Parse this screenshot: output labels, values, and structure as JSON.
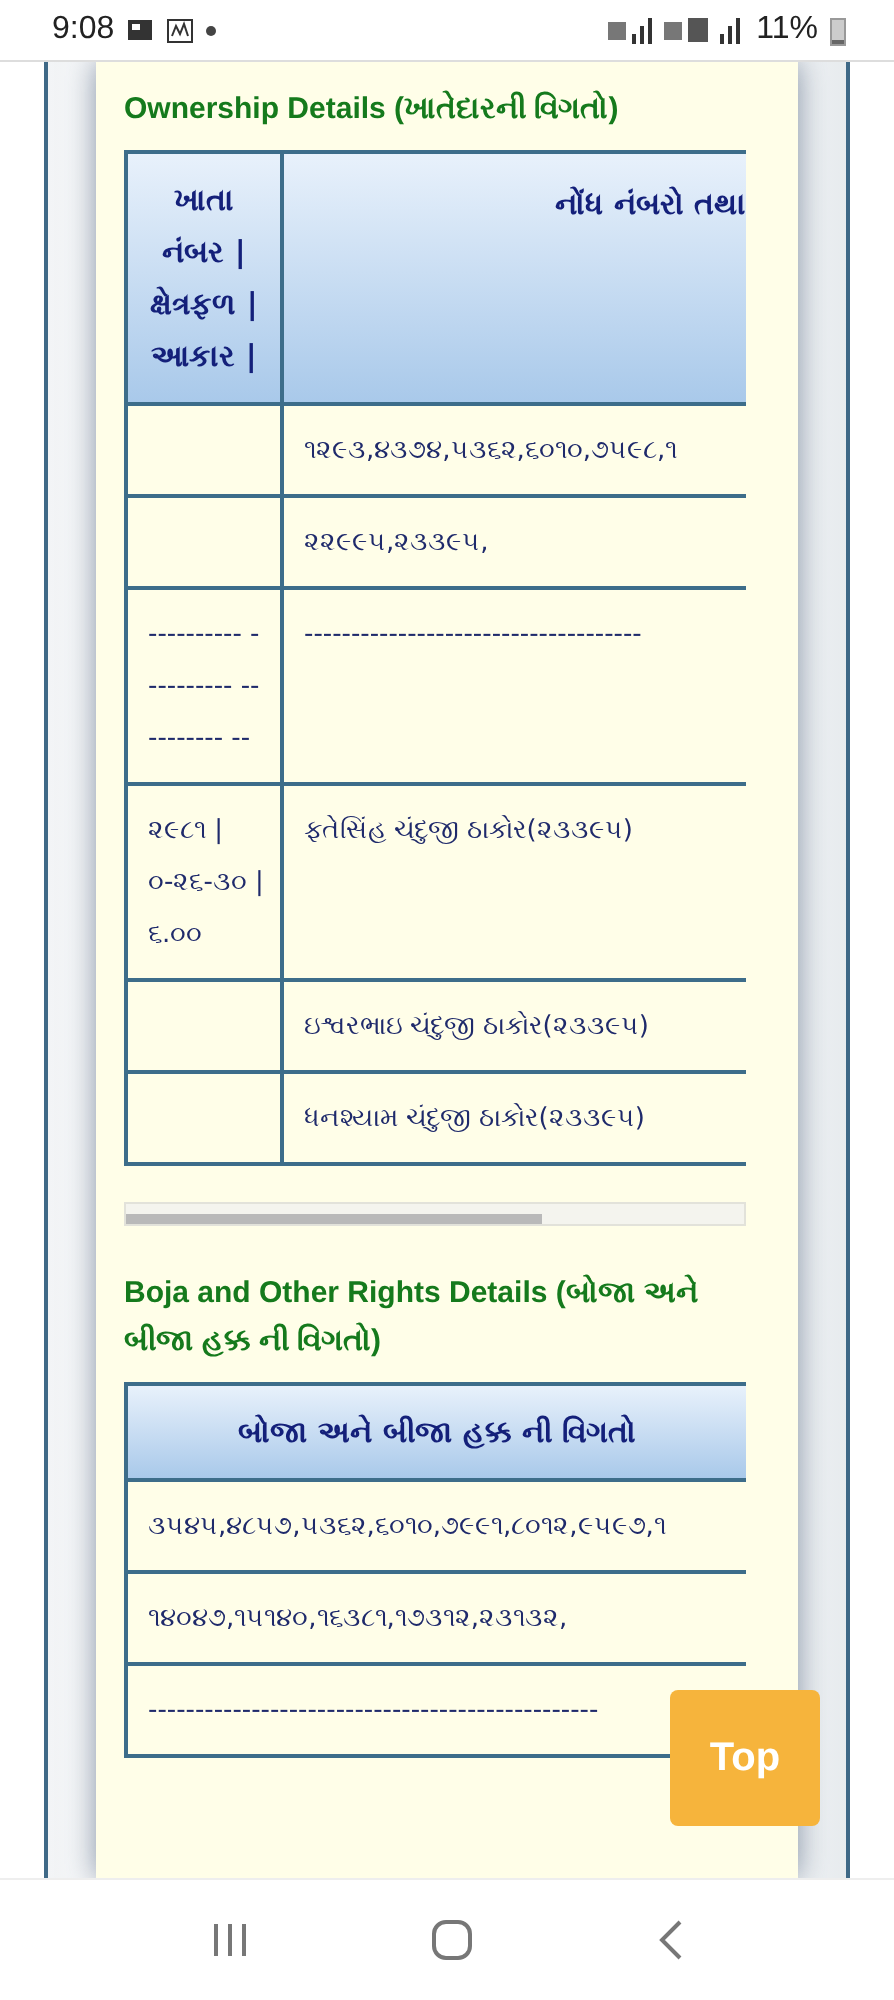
{
  "status_bar": {
    "time": "9:08",
    "battery": "11%"
  },
  "sections": [
    {
      "title": "Ownership Details (ખાતેદારની વિગતો)",
      "columns": [
        "ખાતા નંબર | ક્ષેત્રફળ | આકાર |",
        "નોંધ નંબરો તથા"
      ],
      "rows": [
        [
          "",
          "૧૨૯૩,૪૩૭૪,૫૩૬૨,૬૦૧૦,૭૫૯૮,૧"
        ],
        [
          "",
          "૨૨૯૯૫,૨૩૩૯૫,"
        ],
        [
          "---------- ---------- ---------- --",
          "------------------------------------"
        ],
        [
          "૨૯૮૧ | ૦-૨૬-૩૦ | ૬.૦૦",
          "ફતેસિંહ ચંદુજી ઠાકોર(૨૩૩૯૫)"
        ],
        [
          "",
          "ઇશ્વરભાઇ ચંદુજી ઠાકોર(૨૩૩૯૫)"
        ],
        [
          "",
          "ધનશ્યામ ચંદુજી ઠાકોર(૨૩૩૯૫)"
        ]
      ]
    },
    {
      "title": "Boja and Other Rights Details (બોજા અને બીજા હક્ક ની વિગતો)",
      "columns": [
        "બોજા અને બીજા હક્ક ની વિગતો"
      ],
      "rows": [
        [
          "૩૫૪૫,૪૮૫૭,૫૩૬૨,૬૦૧૦,૭૯૯૧,૮૦૧૨,૯૫૯૭,૧"
        ],
        [
          "૧૪૦૪૭,૧૫૧૪૦,૧૬૩૮૧,૧૭૩૧૨,૨૩૧૩૨,"
        ],
        [
          "------------------------------------------------"
        ]
      ]
    }
  ],
  "top_button": {
    "label": "Top"
  }
}
